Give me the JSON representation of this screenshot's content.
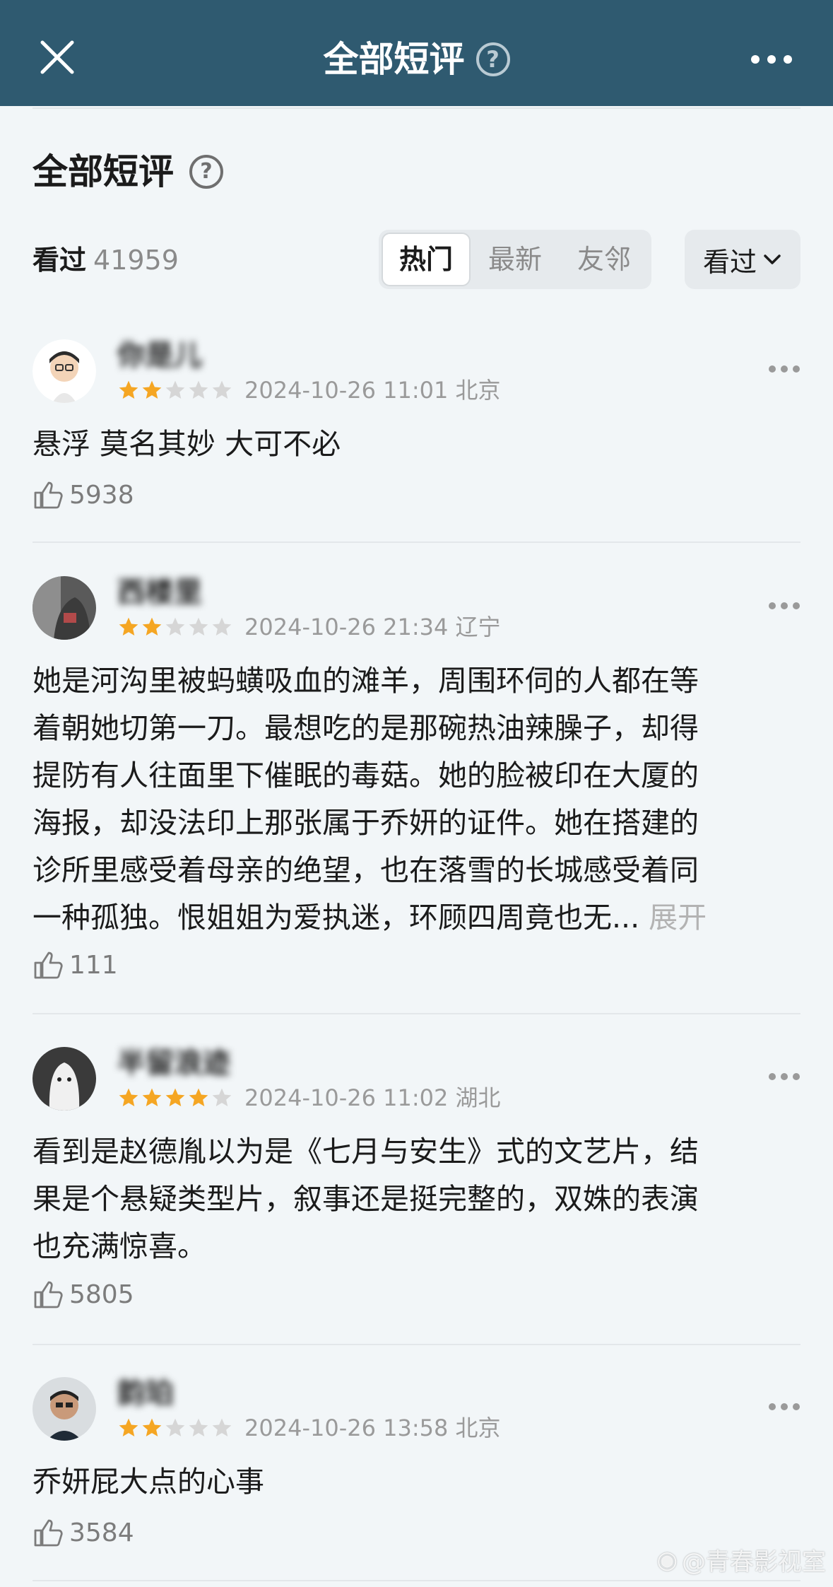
{
  "header": {
    "title": "全部短评",
    "help": "?"
  },
  "section": {
    "title": "全部短评",
    "help": "?"
  },
  "stats": {
    "seen_label": "看过",
    "seen_count": "41959"
  },
  "tabs": [
    {
      "label": "热门",
      "active": true
    },
    {
      "label": "最新",
      "active": false
    },
    {
      "label": "友邻",
      "active": false
    }
  ],
  "filter": {
    "label": "看过"
  },
  "reviews": [
    {
      "user": "你是儿",
      "rating": 2,
      "date": "2024-10-26 11:01 北京",
      "text": "悬浮 莫名其妙 大可不必",
      "likes": "5938"
    },
    {
      "user": "西楼里",
      "rating": 2,
      "date": "2024-10-26 21:34 辽宁",
      "lines": [
        "她是河沟里被蚂蟥吸血的滩羊，周围环伺的人都在等",
        "着朝她切第一刀。最想吃的是那碗热油辣臊子，却得",
        "提防有人往面里下催眠的毒菇。她的脸被印在大厦的",
        "海报，却没法印上那张属于乔妍的证件。她在搭建的",
        "诊所里感受着母亲的绝望，也在落雪的长城感受着同",
        "一种孤独。恨姐姐为爱执迷，环顾四周竟也无..."
      ],
      "expand": "展开",
      "likes": "111"
    },
    {
      "user": "半留浪迹",
      "rating": 4,
      "date": "2024-10-26 11:02 湖北",
      "lines": [
        "看到是赵德胤以为是《七月与安生》式的文艺片，结",
        "果是个悬疑类型片，叙事还是挺完整的，双姝的表演",
        "也充满惊喜。"
      ],
      "likes": "5805"
    },
    {
      "user": "韵珀",
      "rating": 2,
      "date": "2024-10-26 13:58 北京",
      "text": "乔妍屁大点的心事",
      "likes": "3584"
    }
  ],
  "watermark": "@青春影视室",
  "colors": {
    "header_bg": "#2f5a70",
    "star_on": "#f5a623",
    "star_off": "#d6d6d6",
    "page_bg": "#f2f6f8"
  }
}
